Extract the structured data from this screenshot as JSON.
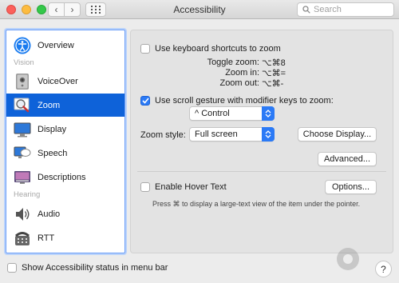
{
  "window": {
    "title": "Accessibility",
    "search_placeholder": "Search"
  },
  "sidebar": {
    "items": [
      {
        "label": "Overview",
        "icon": "accessibility-icon"
      },
      {
        "label": "VoiceOver",
        "icon": "voiceover-icon"
      },
      {
        "label": "Zoom",
        "icon": "zoom-icon",
        "selected": true
      },
      {
        "label": "Display",
        "icon": "display-icon"
      },
      {
        "label": "Speech",
        "icon": "speech-icon"
      },
      {
        "label": "Descriptions",
        "icon": "descriptions-icon"
      },
      {
        "label": "Audio",
        "icon": "audio-icon"
      },
      {
        "label": "RTT",
        "icon": "rtt-icon"
      }
    ],
    "headers": {
      "vision": "Vision",
      "hearing": "Hearing"
    }
  },
  "zoom": {
    "keyboard_shortcuts_label": "Use keyboard shortcuts to zoom",
    "keyboard_shortcuts_checked": false,
    "toggle_zoom_label": "Toggle zoom:",
    "toggle_zoom_keys": "⌥⌘8",
    "zoom_in_label": "Zoom in:",
    "zoom_in_keys": "⌥⌘=",
    "zoom_out_label": "Zoom out:",
    "zoom_out_keys": "⌥⌘-",
    "scroll_gesture_label": "Use scroll gesture with modifier keys to zoom:",
    "scroll_gesture_checked": true,
    "modifier_value": "^ Control",
    "zoom_style_label": "Zoom style:",
    "zoom_style_value": "Full screen",
    "choose_display_label": "Choose Display...",
    "advanced_label": "Advanced...",
    "hover_text_label": "Enable Hover Text",
    "hover_text_checked": false,
    "options_label": "Options...",
    "hover_hint": "Press ⌘ to display a large-text view of the item under the pointer."
  },
  "footer": {
    "status_label": "Show Accessibility status in menu bar",
    "status_checked": false,
    "help_label": "?"
  },
  "colors": {
    "selection": "#0e62d9",
    "accent": "#2b7af6"
  }
}
